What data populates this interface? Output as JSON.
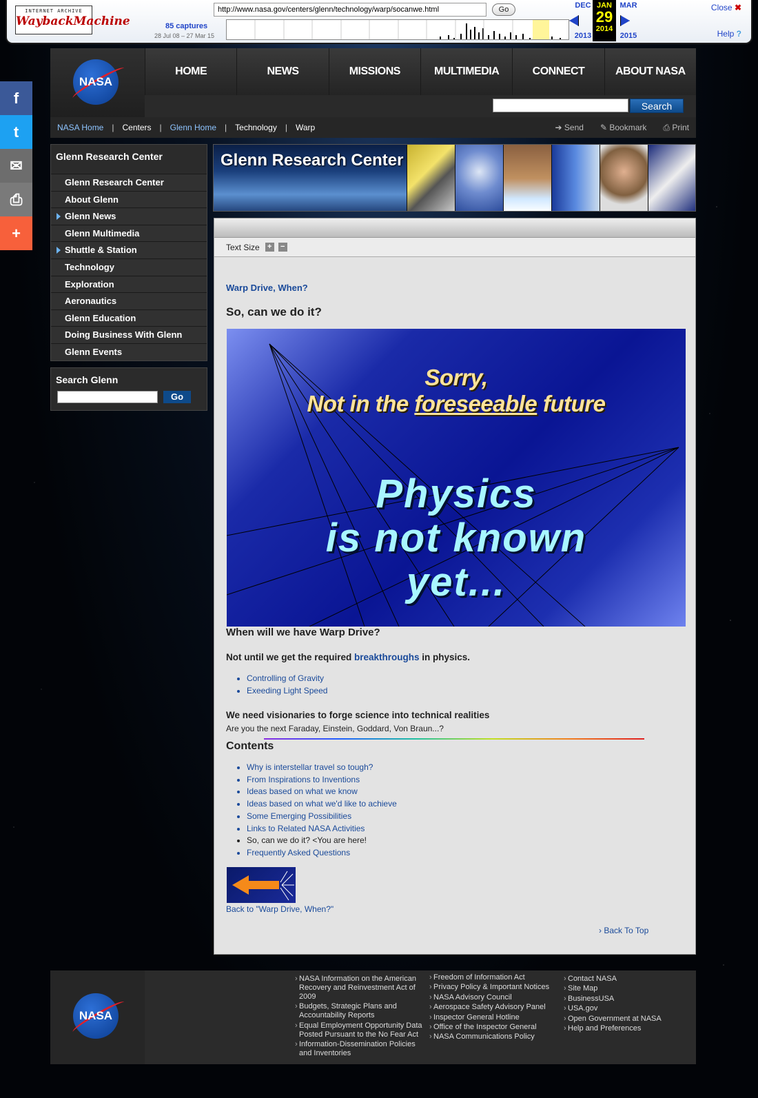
{
  "wayback": {
    "logo_top": "INTERNET ARCHIVE",
    "logo_main": "WaybackMachine",
    "url": "http://www.nasa.gov/centers/glenn/technology/warp/socanwe.html",
    "go": "Go",
    "captures": "85 captures",
    "range": "28 Jul 08 – 27 Mar 15",
    "prev_month": "DEC",
    "prev_year": "2013",
    "cur_month": "JAN",
    "cur_day": "29",
    "cur_year": "2014",
    "next_month": "MAR",
    "next_year": "2015",
    "close": "Close",
    "help": "Help"
  },
  "share": {
    "items": [
      "f",
      "t",
      "✉",
      "⎙",
      "+"
    ],
    "colors": [
      "#3b5998",
      "#1da1f2",
      "#6d6d6d",
      "#7a7a7a",
      "#f7603b"
    ]
  },
  "logo": "NASA",
  "nav": [
    "HOME",
    "NEWS",
    "MISSIONS",
    "MULTIMEDIA",
    "CONNECT",
    "ABOUT NASA"
  ],
  "search_btn": "Search",
  "breadcrumb": [
    "NASA Home",
    "Centers",
    "Glenn Home",
    "Technology",
    "Warp"
  ],
  "tools": [
    "Send",
    "Bookmark",
    "Print"
  ],
  "sidebar": {
    "title": "Glenn Research Center",
    "items": [
      "Glenn Research Center",
      "About Glenn",
      "Glenn News",
      "Glenn Multimedia",
      "Shuttle & Station",
      "Technology",
      "Exploration",
      "Aeronautics",
      "Glenn Education",
      "Doing Business With Glenn",
      "Glenn Events"
    ]
  },
  "search_glenn": {
    "title": "Search Glenn",
    "go": "Go"
  },
  "banner_title": "Glenn Research Center",
  "text_size": "Text Size",
  "content": {
    "kicker": "Warp Drive, When?",
    "heading": "So, can we do it?",
    "slide_line1": "Sorry,",
    "slide_line2_a": "Not in the ",
    "slide_line2_b": "foreseeable",
    "slide_line2_c": " future",
    "slide_big1": "Physics",
    "slide_big2": "is not known",
    "slide_big3": "yet...",
    "q": "When will we have Warp Drive?",
    "answer_a": "Not until we get the required ",
    "answer_link": "breakthroughs",
    "answer_b": " in physics.",
    "bullets": [
      "Controlling of Gravity",
      "Exeeding Light Speed"
    ],
    "visionaries": "We need visionaries to forge science into technical realities",
    "next": "Are you the next Faraday, Einstein, Goddard, Von Braun...?",
    "contents_title": "Contents",
    "contents": [
      "Why is interstellar travel so tough?",
      "From Inspirations to Inventions",
      "Ideas based on what we know",
      "Ideas based on what we'd like to achieve",
      "Some Emerging Possibilities",
      "Links to Related NASA Activities",
      "So, can we do it? <You are here!",
      "Frequently Asked Questions"
    ],
    "back": "Back to \"Warp Drive, When?\"",
    "top": "› Back To Top"
  },
  "footer": {
    "col1": [
      "NASA Information on the American Recovery and Reinvestment Act of 2009",
      "Budgets, Strategic Plans and Accountability Reports",
      "Equal Employment Opportunity Data Posted Pursuant to the No Fear Act",
      "Information-Dissemination Policies and Inventories"
    ],
    "col2": [
      "Freedom of Information Act",
      "Privacy Policy & Important Notices",
      "NASA Advisory Council",
      "Aerospace Safety Advisory Panel",
      "Inspector General Hotline",
      "Office of the Inspector General",
      "NASA Communications Policy"
    ],
    "col3": [
      "Contact NASA",
      "Site Map",
      "BusinessUSA",
      "USA.gov",
      "Open Government at NASA",
      "Help and Preferences"
    ]
  }
}
